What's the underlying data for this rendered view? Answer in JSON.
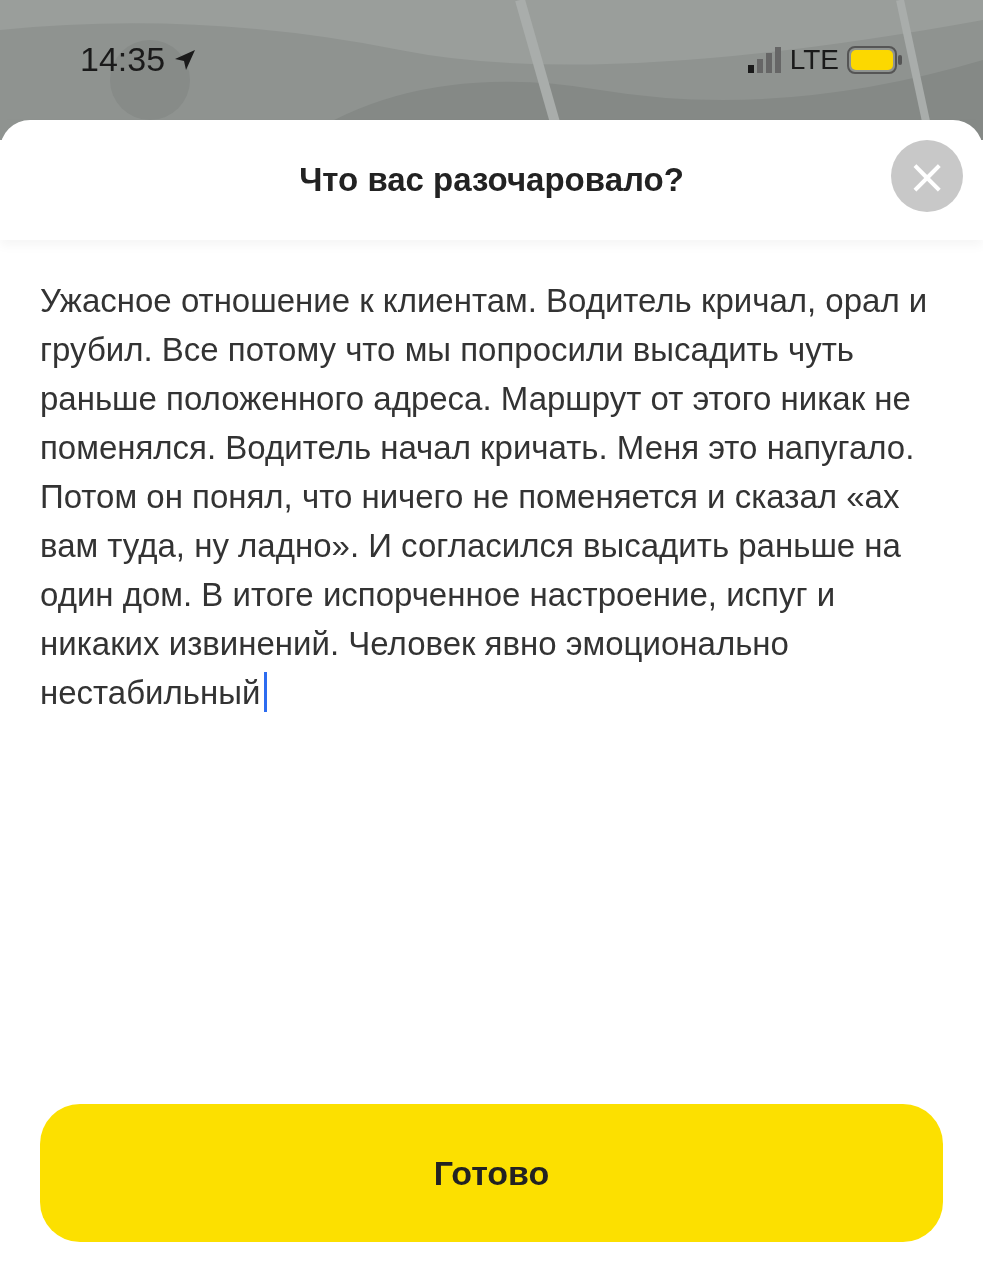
{
  "status_bar": {
    "time": "14:35",
    "network": "LTE"
  },
  "sheet": {
    "title": "Что вас разочаровало?",
    "close_label": "×"
  },
  "review_field": {
    "value": "Ужасное отношение к клиентам. Водитель кричал, орал и грубил. Все потому что мы попросили высадить чуть раньше положенного адреса. Маршрут от этого никак не поменялся. Водитель начал кричать. Меня это напугало. Потом он понял, что ничего не поменяется и сказал «ах вам туда, ну ладно». И согласился высадить раньше на один дом. В итоге испорченное настроение, испуг и никаких извинений. Человек явно эмоционально нестабильный"
  },
  "done_button": {
    "label": "Готово"
  }
}
